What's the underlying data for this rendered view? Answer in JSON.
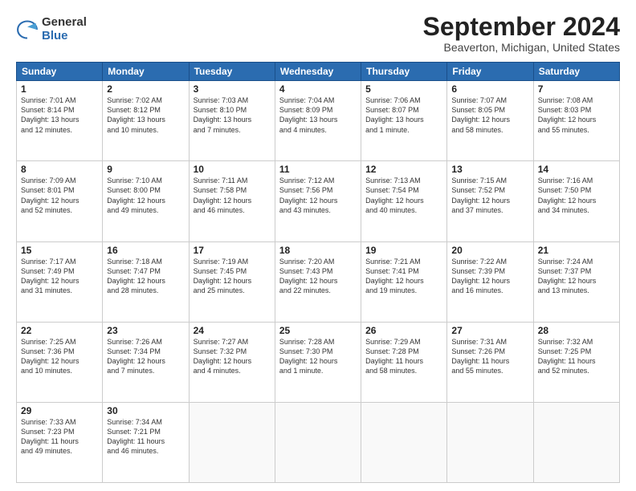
{
  "logo": {
    "general": "General",
    "blue": "Blue"
  },
  "header": {
    "title": "September 2024",
    "subtitle": "Beaverton, Michigan, United States"
  },
  "weekdays": [
    "Sunday",
    "Monday",
    "Tuesday",
    "Wednesday",
    "Thursday",
    "Friday",
    "Saturday"
  ],
  "weeks": [
    [
      {
        "day": "1",
        "info": "Sunrise: 7:01 AM\nSunset: 8:14 PM\nDaylight: 13 hours\nand 12 minutes."
      },
      {
        "day": "2",
        "info": "Sunrise: 7:02 AM\nSunset: 8:12 PM\nDaylight: 13 hours\nand 10 minutes."
      },
      {
        "day": "3",
        "info": "Sunrise: 7:03 AM\nSunset: 8:10 PM\nDaylight: 13 hours\nand 7 minutes."
      },
      {
        "day": "4",
        "info": "Sunrise: 7:04 AM\nSunset: 8:09 PM\nDaylight: 13 hours\nand 4 minutes."
      },
      {
        "day": "5",
        "info": "Sunrise: 7:06 AM\nSunset: 8:07 PM\nDaylight: 13 hours\nand 1 minute."
      },
      {
        "day": "6",
        "info": "Sunrise: 7:07 AM\nSunset: 8:05 PM\nDaylight: 12 hours\nand 58 minutes."
      },
      {
        "day": "7",
        "info": "Sunrise: 7:08 AM\nSunset: 8:03 PM\nDaylight: 12 hours\nand 55 minutes."
      }
    ],
    [
      {
        "day": "8",
        "info": "Sunrise: 7:09 AM\nSunset: 8:01 PM\nDaylight: 12 hours\nand 52 minutes."
      },
      {
        "day": "9",
        "info": "Sunrise: 7:10 AM\nSunset: 8:00 PM\nDaylight: 12 hours\nand 49 minutes."
      },
      {
        "day": "10",
        "info": "Sunrise: 7:11 AM\nSunset: 7:58 PM\nDaylight: 12 hours\nand 46 minutes."
      },
      {
        "day": "11",
        "info": "Sunrise: 7:12 AM\nSunset: 7:56 PM\nDaylight: 12 hours\nand 43 minutes."
      },
      {
        "day": "12",
        "info": "Sunrise: 7:13 AM\nSunset: 7:54 PM\nDaylight: 12 hours\nand 40 minutes."
      },
      {
        "day": "13",
        "info": "Sunrise: 7:15 AM\nSunset: 7:52 PM\nDaylight: 12 hours\nand 37 minutes."
      },
      {
        "day": "14",
        "info": "Sunrise: 7:16 AM\nSunset: 7:50 PM\nDaylight: 12 hours\nand 34 minutes."
      }
    ],
    [
      {
        "day": "15",
        "info": "Sunrise: 7:17 AM\nSunset: 7:49 PM\nDaylight: 12 hours\nand 31 minutes."
      },
      {
        "day": "16",
        "info": "Sunrise: 7:18 AM\nSunset: 7:47 PM\nDaylight: 12 hours\nand 28 minutes."
      },
      {
        "day": "17",
        "info": "Sunrise: 7:19 AM\nSunset: 7:45 PM\nDaylight: 12 hours\nand 25 minutes."
      },
      {
        "day": "18",
        "info": "Sunrise: 7:20 AM\nSunset: 7:43 PM\nDaylight: 12 hours\nand 22 minutes."
      },
      {
        "day": "19",
        "info": "Sunrise: 7:21 AM\nSunset: 7:41 PM\nDaylight: 12 hours\nand 19 minutes."
      },
      {
        "day": "20",
        "info": "Sunrise: 7:22 AM\nSunset: 7:39 PM\nDaylight: 12 hours\nand 16 minutes."
      },
      {
        "day": "21",
        "info": "Sunrise: 7:24 AM\nSunset: 7:37 PM\nDaylight: 12 hours\nand 13 minutes."
      }
    ],
    [
      {
        "day": "22",
        "info": "Sunrise: 7:25 AM\nSunset: 7:36 PM\nDaylight: 12 hours\nand 10 minutes."
      },
      {
        "day": "23",
        "info": "Sunrise: 7:26 AM\nSunset: 7:34 PM\nDaylight: 12 hours\nand 7 minutes."
      },
      {
        "day": "24",
        "info": "Sunrise: 7:27 AM\nSunset: 7:32 PM\nDaylight: 12 hours\nand 4 minutes."
      },
      {
        "day": "25",
        "info": "Sunrise: 7:28 AM\nSunset: 7:30 PM\nDaylight: 12 hours\nand 1 minute."
      },
      {
        "day": "26",
        "info": "Sunrise: 7:29 AM\nSunset: 7:28 PM\nDaylight: 11 hours\nand 58 minutes."
      },
      {
        "day": "27",
        "info": "Sunrise: 7:31 AM\nSunset: 7:26 PM\nDaylight: 11 hours\nand 55 minutes."
      },
      {
        "day": "28",
        "info": "Sunrise: 7:32 AM\nSunset: 7:25 PM\nDaylight: 11 hours\nand 52 minutes."
      }
    ],
    [
      {
        "day": "29",
        "info": "Sunrise: 7:33 AM\nSunset: 7:23 PM\nDaylight: 11 hours\nand 49 minutes."
      },
      {
        "day": "30",
        "info": "Sunrise: 7:34 AM\nSunset: 7:21 PM\nDaylight: 11 hours\nand 46 minutes."
      },
      {
        "day": "",
        "info": ""
      },
      {
        "day": "",
        "info": ""
      },
      {
        "day": "",
        "info": ""
      },
      {
        "day": "",
        "info": ""
      },
      {
        "day": "",
        "info": ""
      }
    ]
  ]
}
